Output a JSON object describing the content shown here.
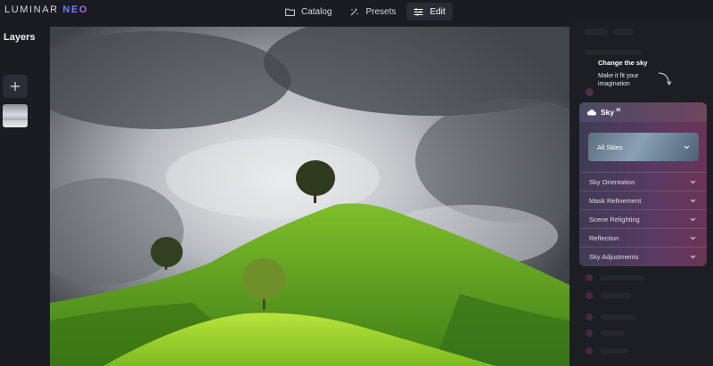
{
  "app": {
    "logo_main": "LUMINAR ",
    "logo_accent": "NEO"
  },
  "nav": [
    {
      "label": "Catalog",
      "icon": "folder-icon"
    },
    {
      "label": "Presets",
      "icon": "presets-icon"
    },
    {
      "label": "Edit",
      "icon": "sliders-icon",
      "active": true
    }
  ],
  "layers": {
    "title": "Layers",
    "add_icon": "plus-icon"
  },
  "promo": {
    "title": "Change the sky",
    "text": "Make it fit your imagination"
  },
  "sky_tool": {
    "title": "Sky",
    "badge": "AI",
    "selected_sky": "All Skies",
    "sections": [
      "Sky Orientation",
      "Mask Refinement",
      "Scene Relighting",
      "Reflection",
      "Sky Adjustments"
    ]
  },
  "colors": {
    "accent_gradient_start": "#4e8cff",
    "accent_gradient_end": "#c05cff",
    "panel": "#1b1c21",
    "sky_card": "#5a3a63"
  }
}
